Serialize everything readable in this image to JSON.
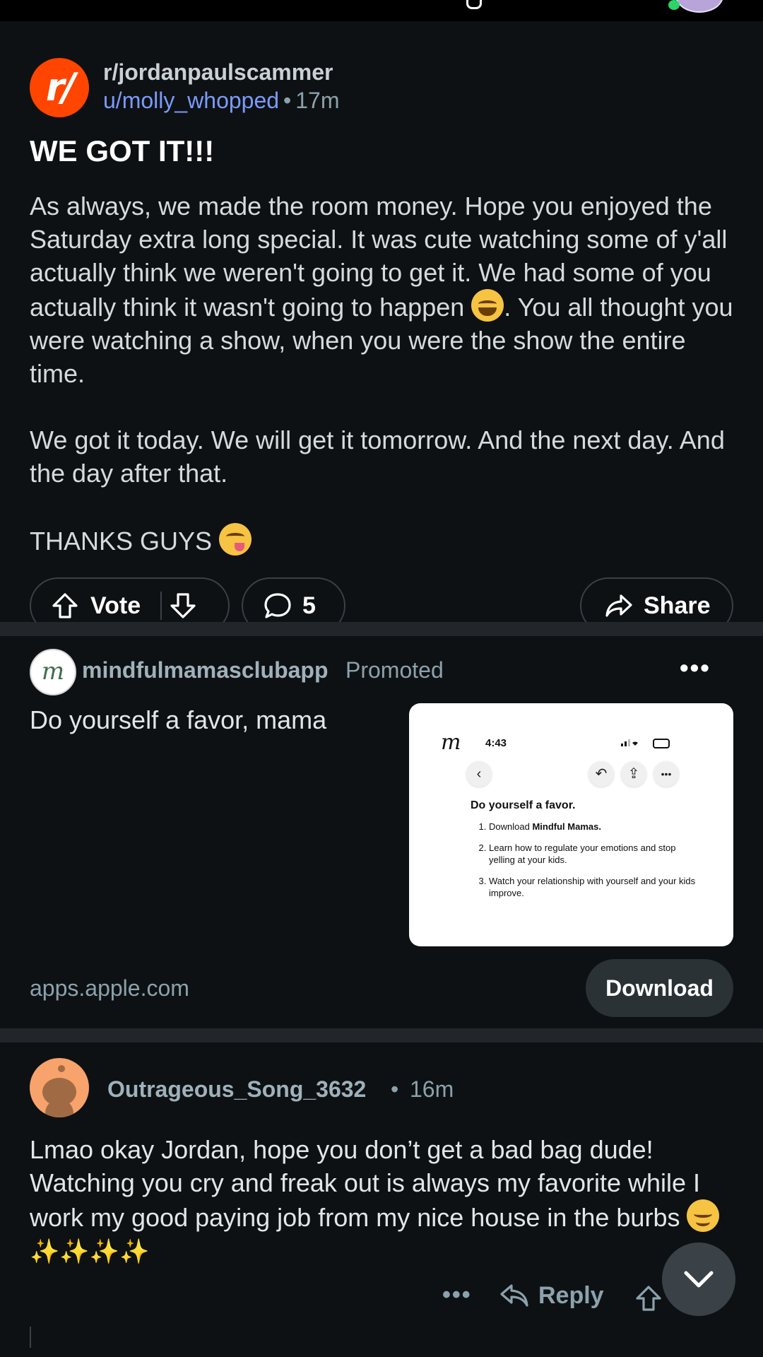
{
  "post": {
    "subreddit": "r/jordanpaulscammer",
    "username": "u/molly_whopped",
    "separator": "•",
    "age": "17m",
    "title": "WE GOT IT!!!",
    "paragraph1_a": "As always, we made the room money. Hope you enjoyed the Saturday extra long special. It was cute watching some of y'all actually think we weren't going to get it. We had some of you actually think it wasn't going to happen",
    "paragraph1_b": ". You all thought you were watching a show, when you were the show the entire time.",
    "paragraph2": "We got it today. We will get it tomorrow. And the next day. And the day after that.",
    "paragraph3": "THANKS GUYS",
    "vote_label": "Vote",
    "comment_count": "5",
    "share_label": "Share",
    "sub_icon_text": "r/"
  },
  "ad": {
    "advertiser": "mindfulmamasclubapp",
    "promoted_label": "Promoted",
    "more": "•••",
    "headline": "Do yourself a favor, mama",
    "card": {
      "logo": "m",
      "clock": "4:43",
      "heading": "Do yourself a favor.",
      "step1_prefix": "Download ",
      "step1_bold": "Mindful Mamas.",
      "step2": "Learn how to regulate your emotions and stop yelling at your kids.",
      "step3": "Watch your relationship with yourself and your kids improve."
    },
    "domain": "apps.apple.com",
    "cta": "Download"
  },
  "comment": {
    "username": "Outrageous_Song_3632",
    "separator": "•",
    "age": "16m",
    "text": "Lmao okay Jordan, hope you don’t get a bad bag dude! Watching you cry and freak out is always my favorite while I work my good paying job from my nice house in the burbs",
    "sparkles": "✨✨✨✨",
    "more": "•••",
    "reply_label": "Reply"
  },
  "colors": {
    "background": "#0e1113",
    "reddit_orange": "#ff4500",
    "link_blue": "#7a9bff",
    "muted": "#8ba2ad",
    "divider": "#202629"
  }
}
